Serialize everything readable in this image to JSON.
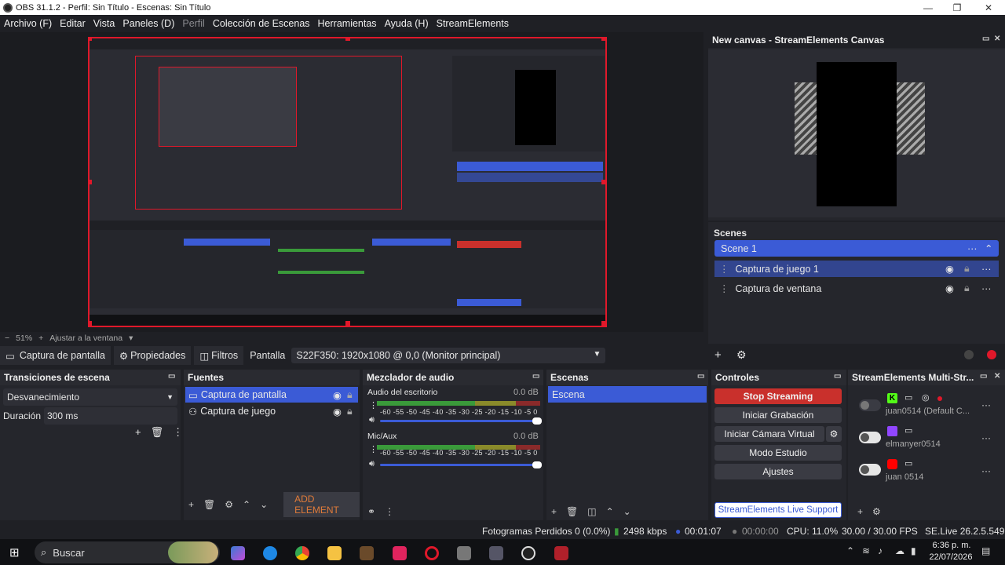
{
  "window": {
    "title": "OBS 31.1.2 - Perfil: Sin Título - Escenas: Sin Título",
    "controls": [
      "—",
      "❐",
      "✕"
    ]
  },
  "menu": [
    "Archivo (F)",
    "Editar",
    "Vista",
    "Paneles (D)",
    "Perfil",
    "Colección de Escenas",
    "Herramientas",
    "Ayuda (H)",
    "StreamElements"
  ],
  "preview": {
    "zoom": "51%",
    "fit_label": "Ajustar a la ventana"
  },
  "canvas_panel": {
    "title": "New canvas - StreamElements Canvas"
  },
  "scenes_panel": {
    "title": "Scenes",
    "scene": "Scene 1",
    "items": [
      "Captura de juego 1",
      "Captura de ventana"
    ]
  },
  "sourcebar": {
    "source_name": "Captura de pantalla",
    "properties": "Propiedades",
    "filters": "Filtros",
    "display_label": "Pantalla",
    "display_value": "S22F350: 1920x1080 @ 0,0 (Monitor principal)"
  },
  "transitions": {
    "title": "Transiciones de escena",
    "selected": "Desvanecimiento",
    "duration_label": "Duración",
    "duration_value": "300 ms"
  },
  "sources": {
    "title": "Fuentes",
    "items": [
      "Captura de pantalla",
      "Captura de juego"
    ],
    "add_element": "ADD ELEMENT"
  },
  "mixer": {
    "title": "Mezclador de audio",
    "channels": [
      {
        "name": "Audio del escritorio",
        "db": "0.0 dB",
        "level": 0.6
      },
      {
        "name": "Mic/Aux",
        "db": "0.0 dB",
        "level": 0.56
      }
    ],
    "scale": "-60 -55 -50 -45 -40 -35 -30 -25 -20 -15 -10 -5 0"
  },
  "scenes_dock": {
    "title": "Escenas",
    "items": [
      "Escena"
    ]
  },
  "controls": {
    "title": "Controles",
    "stop_streaming": "Stop Streaming",
    "start_recording": "Iniciar Grabación",
    "virtual_camera": "Iniciar Cámara Virtual",
    "studio_mode": "Modo Estudio",
    "settings": "Ajustes",
    "support": "StreamElements Live Support"
  },
  "multistream": {
    "title": "StreamElements Multi-Str...",
    "accounts": [
      "juan0514 (Default C...",
      "elmanyer0514",
      "juan 0514"
    ]
  },
  "status": {
    "dropped": "Fotogramas Perdidos 0 (0.0%)",
    "bitrate": "2498 kbps",
    "stream_time": "00:01:07",
    "rec_time": "00:00:00",
    "cpu": "CPU: 11.0%",
    "fps": "30.00 / 30.00 FPS",
    "version": "SE.Live 26.2.5.549"
  },
  "taskbar": {
    "search": "Buscar",
    "time": "6:36 p. m.",
    "date": "22/07/2026"
  },
  "colors": {
    "accent": "#3b5bd6",
    "stop": "#c9302c",
    "selection_border": "#e0182a"
  }
}
